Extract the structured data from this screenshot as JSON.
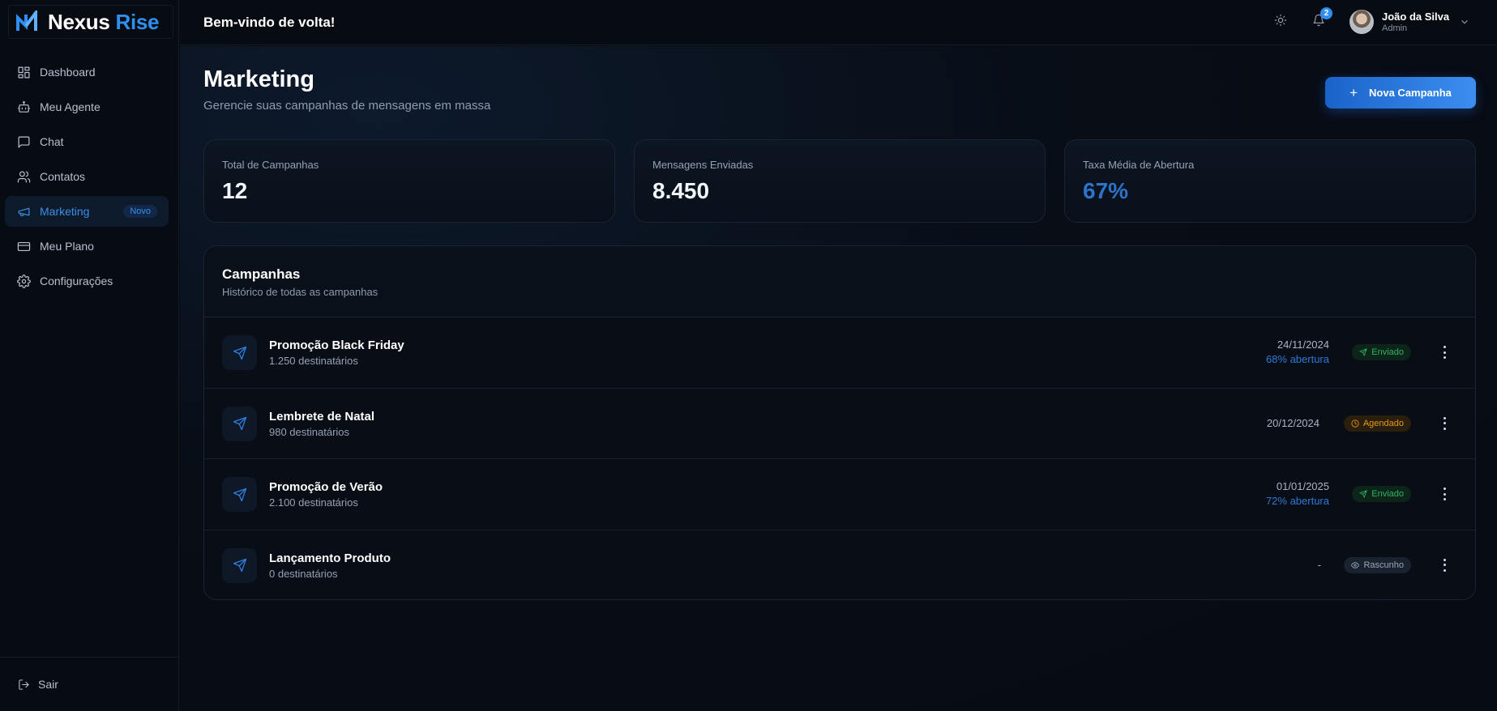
{
  "brand": {
    "name_part1": "Nexus",
    "name_part2": "Rise"
  },
  "sidebar": {
    "items": [
      {
        "label": "Dashboard",
        "icon": "dashboard-icon"
      },
      {
        "label": "Meu Agente",
        "icon": "bot-icon"
      },
      {
        "label": "Chat",
        "icon": "chat-icon"
      },
      {
        "label": "Contatos",
        "icon": "users-icon"
      },
      {
        "label": "Marketing",
        "icon": "megaphone-icon",
        "badge": "Novo",
        "active": true
      },
      {
        "label": "Meu Plano",
        "icon": "credit-card-icon"
      },
      {
        "label": "Configurações",
        "icon": "gear-icon"
      }
    ],
    "logout_label": "Sair"
  },
  "topbar": {
    "welcome": "Bem-vindo de volta!",
    "notifications_count": "2",
    "user_name": "João da Silva",
    "user_role": "Admin"
  },
  "page": {
    "title": "Marketing",
    "subtitle": "Gerencie suas campanhas de mensagens em massa",
    "new_button": "Nova Campanha"
  },
  "stats": [
    {
      "label": "Total de Campanhas",
      "value": "12"
    },
    {
      "label": "Mensagens Enviadas",
      "value": "8.450"
    },
    {
      "label": "Taxa Média de Abertura",
      "value": "67%"
    }
  ],
  "campaigns": {
    "title": "Campanhas",
    "subtitle": "Histórico de todas as campanhas",
    "rows": [
      {
        "name": "Promoção Black Friday",
        "recipients": "1.250 destinatários",
        "date": "24/11/2024",
        "rate": "68% abertura",
        "status": "Enviado"
      },
      {
        "name": "Lembrete de Natal",
        "recipients": "980 destinatários",
        "date": "20/12/2024",
        "rate": "",
        "status": "Agendado"
      },
      {
        "name": "Promoção de Verão",
        "recipients": "2.100 destinatários",
        "date": "01/01/2025",
        "rate": "72% abertura",
        "status": "Enviado"
      },
      {
        "name": "Lançamento Produto",
        "recipients": "0 destinatários",
        "date": "-",
        "rate": "",
        "status": "Rascunho"
      }
    ]
  },
  "colors": {
    "accent": "#2f8ff0",
    "sent": "#2fb365",
    "scheduled": "#e79a1e",
    "draft": "#9aa6b6"
  }
}
